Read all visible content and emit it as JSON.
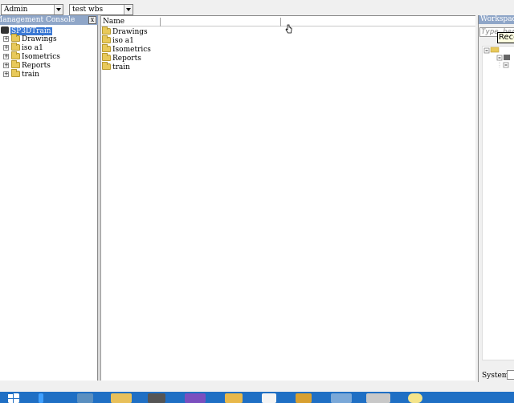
{
  "selectors": {
    "user": "Admin",
    "wbs": "test wbs"
  },
  "left_panel": {
    "title": "Management Console",
    "close_label": "x",
    "root_label": "SP3DTrain",
    "items": [
      {
        "label": "Drawings"
      },
      {
        "label": "iso a1"
      },
      {
        "label": "Isometrics"
      },
      {
        "label": "Reports"
      },
      {
        "label": "train"
      }
    ]
  },
  "list": {
    "column_name": "Name",
    "items": [
      {
        "label": "Drawings"
      },
      {
        "label": "iso a1"
      },
      {
        "label": "Isometrics"
      },
      {
        "label": "Reports"
      },
      {
        "label": "train"
      }
    ]
  },
  "workspace": {
    "title": "Workspace",
    "search_placeholder": "Type here",
    "tooltip": "Recent",
    "tab": "System"
  },
  "taskbar": {
    "colors": {
      "bar": "#1f6fc4"
    },
    "icons": [
      "start-icon",
      "show-desktop-icon",
      "server-manager-icon",
      "file-explorer-icon",
      "application-icon",
      "visual-studio-icon",
      "sql-icon",
      "document-icon",
      "tools-icon",
      "network-icon",
      "monitor-icon",
      "help-icon"
    ]
  }
}
